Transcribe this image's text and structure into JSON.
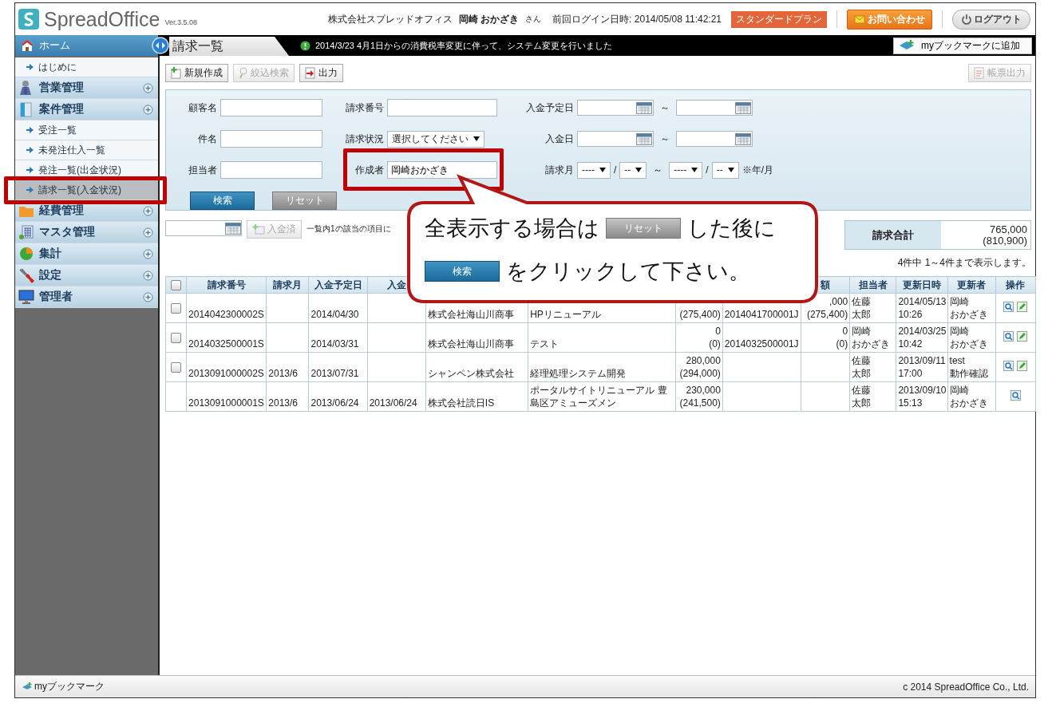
{
  "header": {
    "logo": "SpreadOffice",
    "version": "Ver.3.5.08",
    "company": "株式会社スプレッドオフィス",
    "user": "岡崎 おかざき",
    "honorific": "さん",
    "last_login": "前回ログイン日時: 2014/05/08 11:42:21",
    "plan": "スタンダードプラン",
    "contact_button": "お問い合わせ",
    "logout_button": "ログアウト"
  },
  "nav_bar": {
    "home": "ホーム",
    "tab": "請求一覧",
    "notice": "2014/3/23  4月1日からの消費税率変更に伴って、システム変更を行いました",
    "bookmark_button": "myブックマークに追加"
  },
  "sidebar": {
    "items": [
      {
        "kind": "sub",
        "label": "はじめに",
        "selected": false
      },
      {
        "kind": "group",
        "label": "営業管理"
      },
      {
        "kind": "group",
        "label": "案件管理"
      },
      {
        "kind": "sub",
        "label": "受注一覧",
        "selected": false
      },
      {
        "kind": "sub",
        "label": "未発注仕入一覧",
        "selected": false
      },
      {
        "kind": "sub",
        "label": "発注一覧(出金状況)",
        "selected": false
      },
      {
        "kind": "sub",
        "label": "請求一覧(入金状況)",
        "selected": true
      },
      {
        "kind": "group",
        "label": "経費管理"
      },
      {
        "kind": "group",
        "label": "マスタ管理"
      },
      {
        "kind": "group",
        "label": "集計"
      },
      {
        "kind": "group",
        "label": "設定"
      },
      {
        "kind": "group",
        "label": "管理者"
      }
    ]
  },
  "toolbar": {
    "buttons": [
      {
        "label": "新規作成",
        "disabled": false
      },
      {
        "label": "絞込検索",
        "disabled": true
      },
      {
        "label": "出力",
        "disabled": false
      }
    ],
    "report_button": {
      "label": "帳票出力",
      "disabled": true
    }
  },
  "search": {
    "fields": [
      {
        "kind": "text",
        "label": "顧客名"
      },
      {
        "kind": "text",
        "label": "請求番号"
      },
      {
        "kind": "date_range",
        "label": "入金予定日",
        "separator": "～"
      },
      {
        "kind": "text",
        "label": "件名"
      },
      {
        "kind": "select",
        "label": "請求状況",
        "value": "選択してください"
      },
      {
        "kind": "date_range",
        "label": "入金日",
        "separator": "～"
      },
      {
        "kind": "text",
        "label": "担当者"
      },
      {
        "kind": "text",
        "label": "作成者",
        "value": "岡崎おかざき"
      },
      {
        "kind": "month_range",
        "label": "請求月",
        "from": {
          "year": "----",
          "slash": "/",
          "month": "--"
        },
        "separator": "～",
        "to": {
          "year": "----",
          "slash": "/",
          "month": "--"
        },
        "note": "※年/月"
      }
    ],
    "search_button": "検索",
    "reset_button": "リセット"
  },
  "list_bar": {
    "paid_button": {
      "label": "入金済",
      "disabled": true
    },
    "hint": "一覧内1の該当の項目に",
    "total": {
      "label": "請求合計",
      "value": "765,000",
      "tax_value": "(810,900)"
    },
    "count": "4件中 1～4件まで表示します。"
  },
  "table": {
    "header_checked": false,
    "columns": [
      {
        "label": "請求番号"
      },
      {
        "label": "請求月"
      },
      {
        "label": "入金予定日"
      },
      {
        "label": "入金"
      },
      {},
      {},
      {},
      {},
      {
        "label": "額"
      },
      {
        "label": "担当者"
      },
      {
        "label": "更新日時"
      },
      {
        "label": "更新者"
      },
      {
        "label": "操作"
      }
    ],
    "rows": [
      {
        "checked": false,
        "editable": true,
        "cells": [
          "2014042300002S",
          null,
          "2014/04/30",
          null,
          "株式会社海山川商事",
          "HPリニューアル",
          "(275,400)",
          "2014041700001J",
          [
            ",000",
            "(275,400)"
          ],
          [
            "佐藤",
            "太郎"
          ],
          [
            "2014/05/13",
            "10:26"
          ],
          [
            "岡崎",
            "おかざき"
          ]
        ]
      },
      {
        "checked": false,
        "editable": true,
        "cells": [
          "2014032500001S",
          null,
          "2014/03/31",
          null,
          "株式会社海山川商事",
          "テスト",
          [
            "0",
            "(0)"
          ],
          "2014032500001J",
          [
            "0",
            "(0)"
          ],
          [
            "岡崎",
            "おかざき"
          ],
          [
            "2014/03/25",
            "10:42"
          ],
          [
            "岡崎",
            "おかざき"
          ]
        ]
      },
      {
        "checked": false,
        "editable": true,
        "cells": [
          "2013091000002S",
          "2013/6",
          "2013/07/31",
          null,
          "シャンペン株式会社",
          "経理処理システム開発",
          [
            "280,000",
            "(294,000)"
          ],
          null,
          null,
          [
            "佐藤",
            "太郎"
          ],
          [
            "2013/09/11",
            "17:00"
          ],
          [
            "test",
            "動作確認"
          ]
        ]
      },
      {
        "editable": false,
        "cells": [
          "2013091000001S",
          "2013/6",
          "2013/06/24",
          "2013/06/24",
          "株式会社読日IS",
          "ポータルサイトリニューアル 豊島区アミューズメン",
          [
            "230,000",
            "(241,500)"
          ],
          null,
          null,
          [
            "佐藤",
            "太郎"
          ],
          [
            "2013/09/10",
            "15:13"
          ],
          [
            "岡崎",
            "おかざき"
          ]
        ]
      }
    ]
  },
  "callout": {
    "line1_before": "全表示する場合は",
    "reset_chip": "リセット",
    "line1_after": "した後に",
    "search_chip": "検索",
    "line2_after": "をクリックして下さい。"
  },
  "footer": {
    "bookmarks": "myブックマーク",
    "copyright": "c 2014 SpreadOffice Co., Ltd."
  }
}
